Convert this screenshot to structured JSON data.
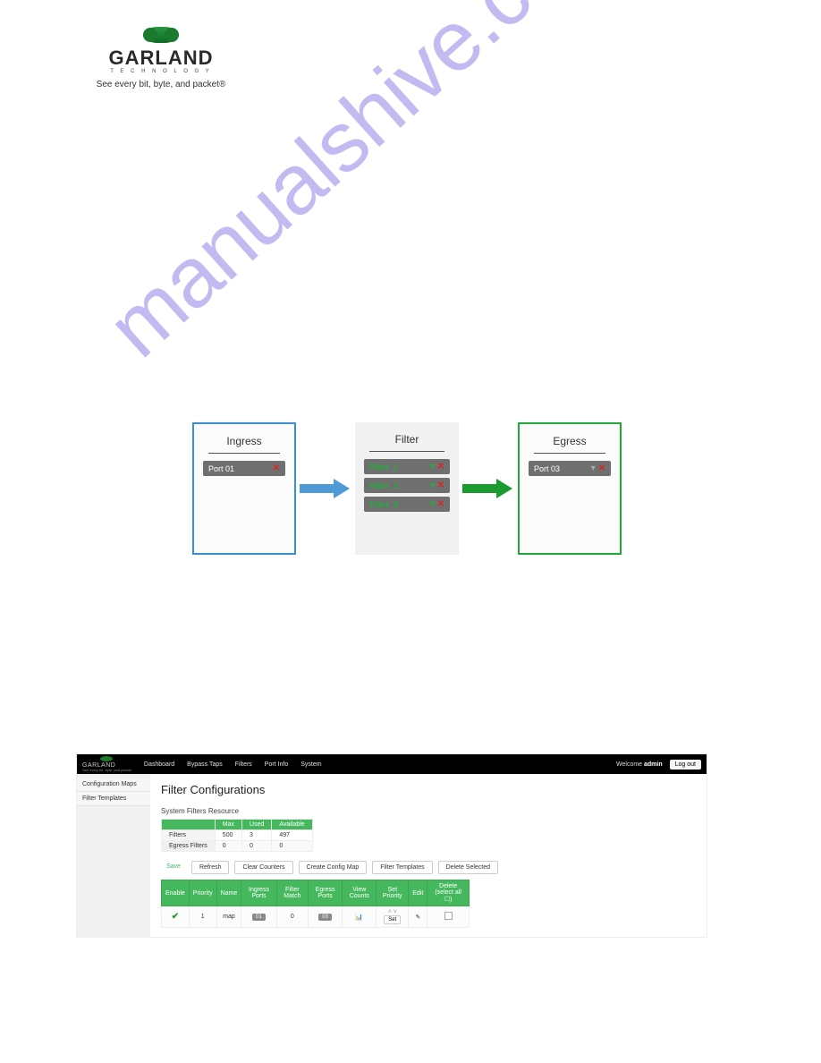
{
  "logo": {
    "brand": "GARLAND",
    "subline": "T E C H N O L O G Y",
    "tagline": "See every bit, byte, and packet®"
  },
  "watermark": "manualshive.com",
  "diagram": {
    "ingress": {
      "title": "Ingress",
      "port": "Port 01"
    },
    "filter": {
      "title": "Filter",
      "items": [
        "Filter_1",
        "Filter_2",
        "Filter_3"
      ]
    },
    "egress": {
      "title": "Egress",
      "port": "Port 03"
    }
  },
  "shot": {
    "brand": "GARLAND",
    "brand_sub": "See every bit, byte, and packet",
    "nav": [
      "Dashboard",
      "Bypass Taps",
      "Filters",
      "Port Info",
      "System"
    ],
    "welcome_prefix": "Welcome ",
    "welcome_user": "admin",
    "logout": "Log out",
    "side": [
      {
        "label": "Configuration Maps"
      },
      {
        "label": "Filter Templates"
      }
    ],
    "page_title": "Filter Configurations",
    "resource_label": "System Filters Resource",
    "resource": {
      "headers": [
        "",
        "Max",
        "Used",
        "Available"
      ],
      "rows": [
        {
          "label": "Filters",
          "max": "500",
          "used": "3",
          "available": "497"
        },
        {
          "label": "Egress Filters",
          "max": "0",
          "used": "0",
          "available": "0"
        }
      ]
    },
    "btns": {
      "save": "Save",
      "refresh": "Refresh",
      "clear": "Clear Counters",
      "create": "Create Config Map",
      "templates": "Filter Templates",
      "delete": "Delete Selected"
    },
    "cfg": {
      "headers": [
        "Enable",
        "Priority",
        "Name",
        "Ingress Ports",
        "Filter Match",
        "Egress Ports",
        "View Counts",
        "Set Priority",
        "Edit",
        "Delete (select all ☐)"
      ],
      "row": {
        "enable": "✔",
        "priority": "1",
        "name": "map",
        "ingress": "01",
        "filter_match": "0",
        "egress": "03",
        "set_btn": "Set"
      }
    }
  }
}
